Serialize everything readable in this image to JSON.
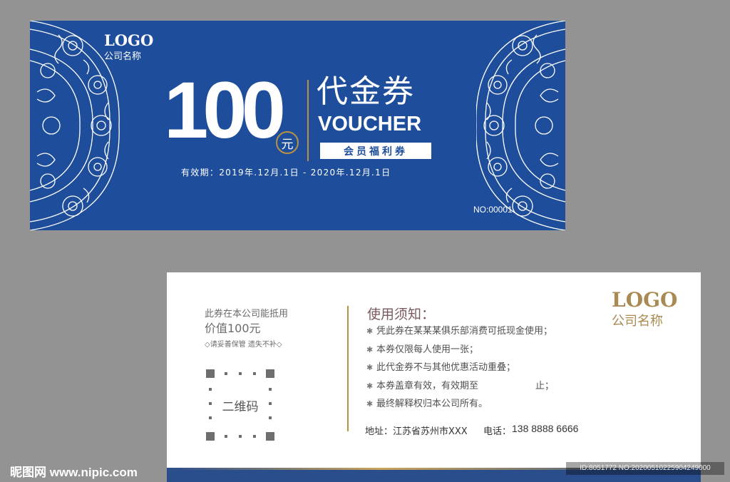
{
  "front": {
    "logo": "LOGO",
    "company": "公司名称",
    "amount": "100",
    "yuan": "元",
    "title_cn": "代金券",
    "title_en": "VOUCHER",
    "badge": "会员福利券",
    "validity": "有效期：2019年.12月.1日 - 2020年.12月.1日",
    "serial": "NO:00001",
    "colors": {
      "background": "#1e4e9b",
      "accent_gold": "#b8923f"
    }
  },
  "back": {
    "value_line1": "此券在本公司能抵用",
    "value_line2": "价值100元",
    "care_note": "◇请妥善保管 遗失不补◇",
    "qr_label": "二维码",
    "rules_title": "使用须知：",
    "rules": [
      {
        "text": "凭此券在某某某俱乐部消费可抵现金使用；",
        "tail": ""
      },
      {
        "text": "本券仅限每人使用一张；",
        "tail": ""
      },
      {
        "text": "此代金券不与其他优惠活动重叠；",
        "tail": ""
      },
      {
        "text": "本券盖章有效，有效期至",
        "tail": "止；"
      },
      {
        "text": "最终解释权归本公司所有。",
        "tail": ""
      }
    ],
    "address": "地址：江苏省苏州市XXX",
    "phone_label": "电话：",
    "phone": "138 8888 6666",
    "logo": "LOGO",
    "company": "公司名称",
    "colors": {
      "gold": "#a88a52",
      "bar": "#2a4d8b"
    }
  },
  "watermark": {
    "left": "昵图网 www.nipic.com",
    "right": "ID:8051772 NO:20200510225904249000"
  }
}
